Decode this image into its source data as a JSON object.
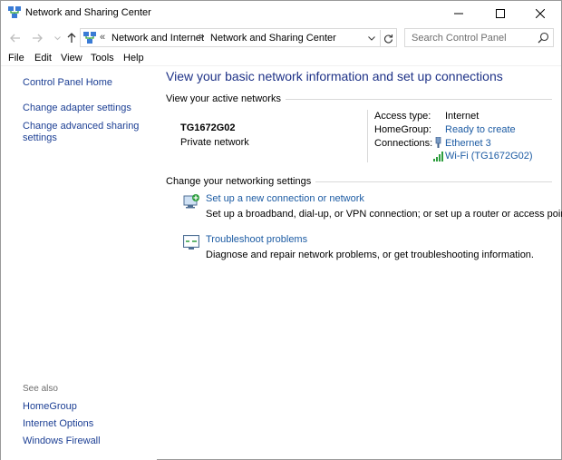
{
  "window": {
    "title": "Network and Sharing Center"
  },
  "address": {
    "chevron": "«",
    "crumbs": [
      "Network and Internet",
      "Network and Sharing Center"
    ],
    "separator": ">"
  },
  "search": {
    "placeholder": "Search Control Panel"
  },
  "menu": {
    "items": [
      "File",
      "Edit",
      "View",
      "Tools",
      "Help"
    ]
  },
  "sidebar": {
    "home": "Control Panel Home",
    "links": [
      "Change adapter settings",
      "Change advanced sharing",
      "settings"
    ],
    "see_also_label": "See also",
    "see_also": [
      "HomeGroup",
      "Internet Options",
      "Windows Firewall"
    ]
  },
  "main": {
    "title": "View your basic network information and set up connections",
    "active_networks_heading": "View your active networks",
    "network": {
      "name": "TG1672G02",
      "category": "Private network",
      "access_type_label": "Access type:",
      "access_type": "Internet",
      "homegroup_label": "HomeGroup:",
      "homegroup": "Ready to create",
      "connections_label": "Connections:",
      "connections": [
        "Ethernet 3",
        "Wi-Fi (TG1672G02)"
      ]
    },
    "change_settings_heading": "Change your networking settings",
    "tasks": [
      {
        "link": "Set up a new connection or network",
        "desc": "Set up a broadband, dial-up, or VPN connection; or set up a router or access point."
      },
      {
        "link": "Troubleshoot problems",
        "desc": "Diagnose and repair network problems, or get troubleshooting information."
      }
    ]
  },
  "colors": {
    "title_blue": "#1e3287",
    "link_blue": "#1c5ba3",
    "border": "#d9d9d9"
  }
}
